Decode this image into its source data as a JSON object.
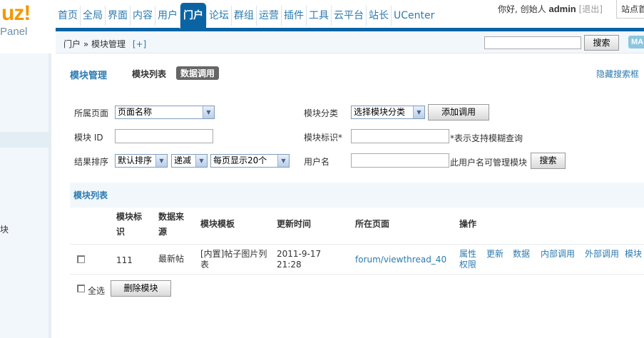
{
  "logo": {
    "text": "uz!",
    "subtitle": "Panel"
  },
  "sidebar": {
    "label": "块"
  },
  "nav": {
    "tabs": [
      "首页",
      "全局",
      "界面",
      "内容",
      "用户",
      "门户",
      "论坛",
      "群组",
      "运营",
      "插件",
      "工具",
      "云平台",
      "站长",
      "UCenter"
    ],
    "active": "门户",
    "greeting": "你好, 创始人",
    "username": "admin",
    "logout": "[退出]",
    "site": "站点首页"
  },
  "breadcrumb": {
    "path": "门户 » 模块管理",
    "add": "[+]"
  },
  "top_search": {
    "button": "搜索",
    "map": "MA"
  },
  "page": {
    "title": "模块管理",
    "tab_list": "模块列表",
    "tab_data": "数据调用",
    "hide_search": "隐藏搜索框"
  },
  "filters": {
    "page_label": "所属页面",
    "page_select": "页面名称",
    "id_label": "模块 ID",
    "sort_label": "结果排序",
    "sort_default": "默认排序",
    "sort_order": "递减",
    "per_page": "每页显示20个",
    "category_label": "模块分类",
    "category_select": "选择模块分类",
    "add_button": "添加调用",
    "ident_label": "模块标识*",
    "ident_hint": "*表示支持模糊查询",
    "user_label": "用户名",
    "user_hint": "此用户名可管理模块",
    "search_button": "搜索"
  },
  "list": {
    "section_title": "模块列表",
    "headers": {
      "id_line1": "模块标",
      "id_line2": "识",
      "source_line1": "数据来",
      "source_line2": "源",
      "template": "模块模板",
      "updated": "更新时间",
      "page": "所在页面",
      "ops": "操作"
    },
    "rows": [
      {
        "id": "111",
        "source": "最新帖",
        "template_line1": "[内置]帖子图片列",
        "template_line2": "表",
        "updated_line1": "2011-9-17",
        "updated_line2": "21:28",
        "page": "forum/viewthread_40",
        "op_props_line1": "属性",
        "op_props_line2": "权限",
        "op_update": "更新",
        "op_data": "数据",
        "op_internal": "内部调用",
        "op_external": "外部调用",
        "op_more": "模块"
      }
    ],
    "select_all": "全选",
    "delete_button": "删除模块"
  }
}
